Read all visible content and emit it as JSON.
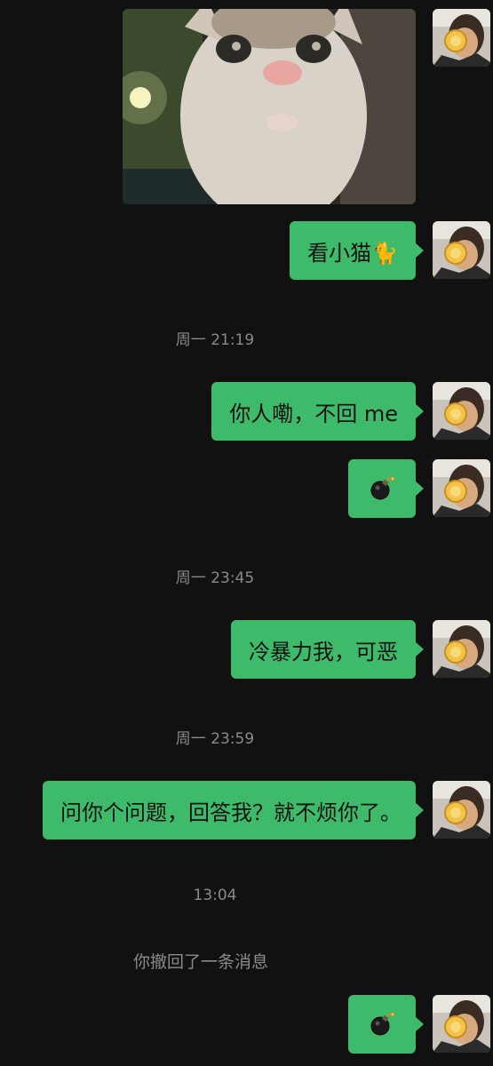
{
  "messages": {
    "m1_text": "看小猫🐈",
    "m2_text": "你人嘞，不回 me",
    "m3_emoji": "bomb-emoji",
    "m4_text": "冷暴力我，可恶",
    "m5_text": "问你个问题，回答我？就不烦你了。",
    "m6_emoji": "bomb-emoji"
  },
  "timestamps": {
    "t1": "周一 21:19",
    "t2": "周一 23:45",
    "t3": "周一 23:59",
    "t4": "13:04"
  },
  "system": {
    "recall_notice": "你撤回了一条消息"
  },
  "colors": {
    "background": "#111111",
    "bubble": "#3ebb6a",
    "timestamp": "#8a8a8a"
  }
}
